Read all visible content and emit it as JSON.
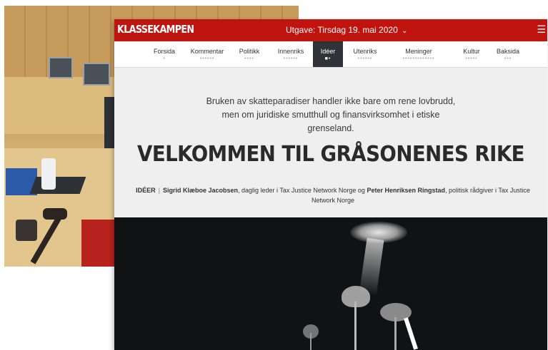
{
  "site": {
    "logo": "KLASSEKAMPEN",
    "edition_label": "Utgave: Tirsdag 19. mai 2020",
    "edition_chevron": "⌄",
    "menu_icon": "☰"
  },
  "nav": {
    "items": [
      {
        "label": "Forsida",
        "dots": "•"
      },
      {
        "label": "Kommentar",
        "dots": "••••••"
      },
      {
        "label": "Politikk",
        "dots": "••••"
      },
      {
        "label": "Innenriks",
        "dots": "••••••"
      },
      {
        "label": "Idéer",
        "dots": "■•"
      },
      {
        "label": "Utenriks",
        "dots": "••••••"
      },
      {
        "label": "Meninger",
        "dots": "•••••••••••••"
      },
      {
        "label": "Kultur",
        "dots": "•••••"
      },
      {
        "label": "Baksida",
        "dots": "•••"
      }
    ],
    "active_index": 4
  },
  "article": {
    "lead": "Bruken av skatteparadiser handler ikke bare om rene lovbrudd, men om juridiske smutthull og finansvirksomhet i etiske grenseland.",
    "headline": "VELKOMMEN TIL GRÅSONENES RIKE",
    "section_tag": "IDÉER",
    "separator": "|",
    "author1": "Sigrid Klæboe Jacobsen",
    "author1_role": ", daglig leder i Tax Justice Network Norge og ",
    "author2": "Peter Henriksen Ringstad",
    "author2_role": ", politisk rådgiver i Tax Justice Network Norge"
  },
  "colors": {
    "brand_red": "#c0140f",
    "active_tab": "#2f3338",
    "page_bg": "#efefef"
  }
}
